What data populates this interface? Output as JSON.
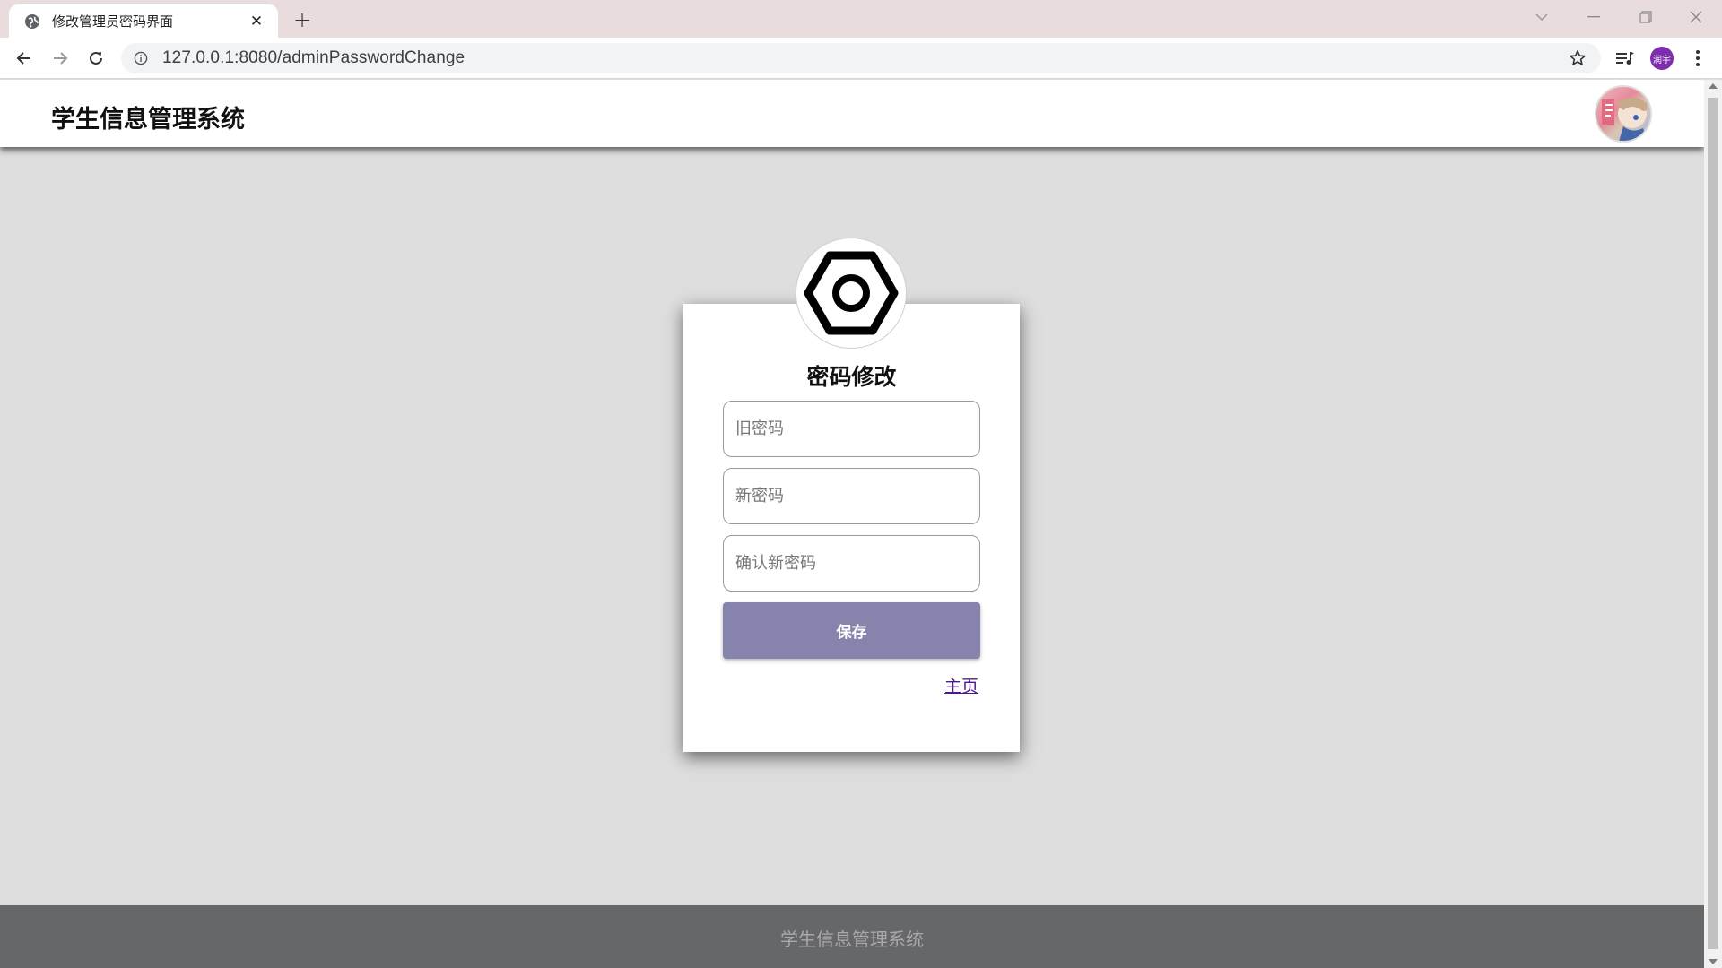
{
  "browser": {
    "tab_title": "修改管理员密码界面",
    "tab_close": "✕",
    "new_tab": "+",
    "url": "127.0.0.1:8080/adminPasswordChange",
    "profile_initials": "润宇"
  },
  "header": {
    "site_title": "学生信息管理系统"
  },
  "form": {
    "title": "密码修改",
    "old_password_placeholder": "旧密码",
    "new_password_placeholder": "新密码",
    "confirm_password_placeholder": "确认新密码",
    "save_label": "保存",
    "home_link": "主页"
  },
  "footer": {
    "text": "学生信息管理系统"
  },
  "colors": {
    "save_button": "#8683ad",
    "footer_bg": "#666769",
    "page_bg": "#dedede",
    "link": "#4b1a8a"
  }
}
